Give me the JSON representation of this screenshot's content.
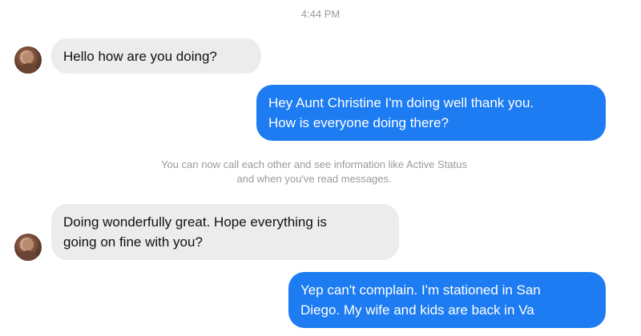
{
  "thread": {
    "timestamp": "4:44 PM",
    "messages": [
      {
        "from": "them",
        "text": "Hello how are you doing?"
      },
      {
        "from": "me",
        "lines": [
          "Hey Aunt Christine I'm doing well thank you.",
          "How is everyone doing there?"
        ]
      },
      {
        "from": "them",
        "lines": [
          "Doing wonderfully great. Hope everything is",
          "going on fine with you?"
        ]
      },
      {
        "from": "me",
        "lines": [
          "Yep can't complain. I'm stationed in San",
          "Diego. My wife and kids are back in Va"
        ]
      }
    ],
    "system_notice": {
      "lines": [
        "You can now call each other and see information like Active Status",
        "and when you've read messages."
      ]
    }
  },
  "colors": {
    "outgoing_bubble": "#1d7cf2",
    "incoming_bubble": "#ececec",
    "meta_text": "#9a9a9a"
  }
}
